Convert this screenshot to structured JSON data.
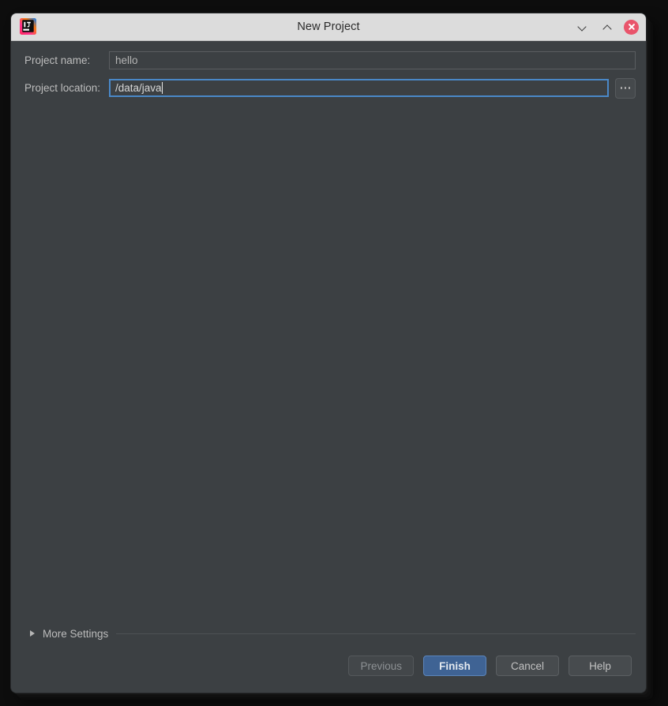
{
  "window": {
    "title": "New Project",
    "app_icon": "intellij-idea-icon",
    "controls": {
      "minimize": "chevron-down-icon",
      "maximize": "chevron-up-icon",
      "close": "close-icon"
    }
  },
  "form": {
    "project_name": {
      "label": "Project name:",
      "value": "hello",
      "placeholder": ""
    },
    "project_location": {
      "label": "Project location:",
      "value": "/data/java",
      "placeholder": "",
      "browse_label": "..."
    }
  },
  "more_settings": {
    "label": "More Settings",
    "expanded": false,
    "arrow_icon": "triangle-right-icon"
  },
  "footer": {
    "buttons": [
      {
        "label": "Previous",
        "state": "disabled",
        "name": "previous-button"
      },
      {
        "label": "Finish",
        "state": "default",
        "name": "finish-button"
      },
      {
        "label": "Cancel",
        "state": "normal",
        "name": "cancel-button"
      },
      {
        "label": "Help",
        "state": "normal",
        "name": "help-button"
      }
    ]
  },
  "colors": {
    "dialog_background": "#3c4043",
    "titlebar_background": "#dcdcdc",
    "titlebar_text": "#2b2b2b",
    "field_border": "#5a5d60",
    "focus_border": "#4a88c7",
    "default_button": "#3f6394",
    "close_button": "#e9546b",
    "text_primary": "#bdbdbd",
    "scrollbar_thumb": "#a9abad"
  }
}
